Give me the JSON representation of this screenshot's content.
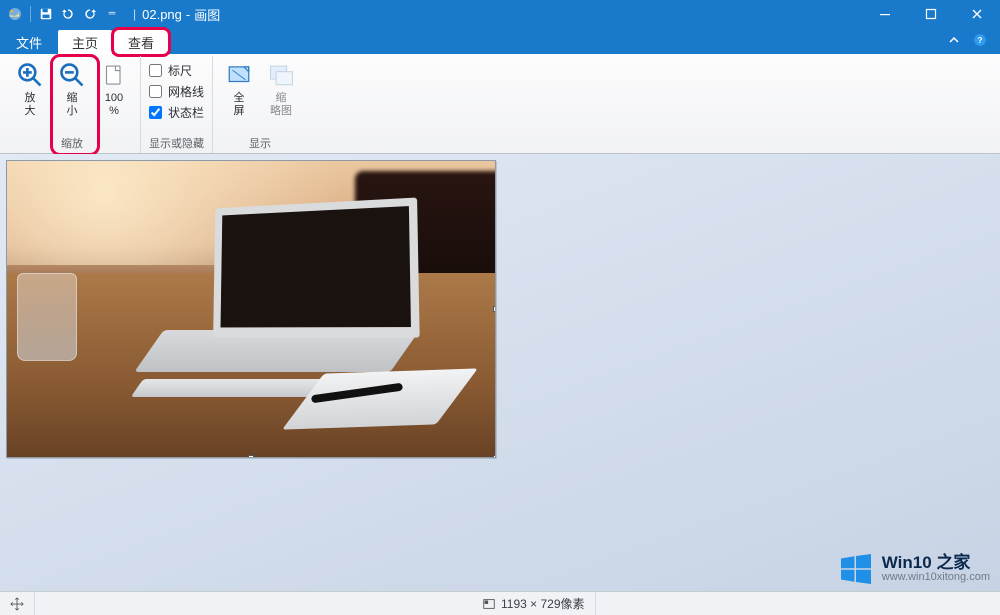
{
  "titlebar": {
    "filename": "02.png",
    "appname": "画图",
    "separator": "-"
  },
  "tabs": {
    "file": "文件",
    "home": "主页",
    "view": "查看"
  },
  "ribbon": {
    "zoom": {
      "zoom_in": "放\n大",
      "zoom_out": "缩\n小",
      "hundred": "100\n%",
      "group_label": "缩放"
    },
    "showHide": {
      "ruler": "标尺",
      "gridlines": "网格线",
      "statusbar": "状态栏",
      "group_label": "显示或隐藏",
      "ruler_checked": false,
      "gridlines_checked": false,
      "statusbar_checked": true
    },
    "display": {
      "full_screen": "全\n屏",
      "thumbnail": "缩\n略图",
      "group_label": "显示"
    }
  },
  "statusbar": {
    "dimensions": "1193 × 729像素"
  },
  "watermark": {
    "brand_en": "Win10",
    "brand_zh": "之家",
    "url": "www.win10xitong.com"
  }
}
